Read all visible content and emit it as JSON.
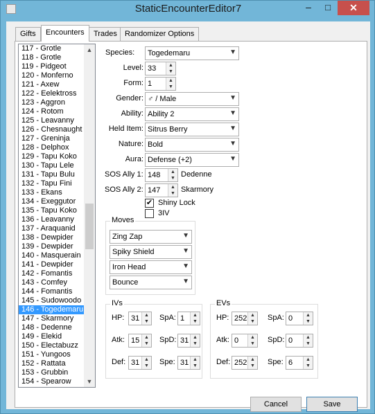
{
  "window": {
    "title": "StaticEncounterEditor7",
    "minimize": "–",
    "maximize": "□",
    "close": "✕"
  },
  "tabs": [
    "Gifts",
    "Encounters",
    "Trades",
    "Randomizer Options"
  ],
  "list": {
    "items": [
      "117 - Grotle",
      "118 - Grotle",
      "119 - Pidgeot",
      "120 - Monferno",
      "121 - Axew",
      "122 - Eelektross",
      "123 - Aggron",
      "124 - Rotom",
      "125 - Leavanny",
      "126 - Chesnaught",
      "127 - Greninja",
      "128 - Delphox",
      "129 - Tapu Koko",
      "130 - Tapu Lele",
      "131 - Tapu Bulu",
      "132 - Tapu Fini",
      "133 - Ekans",
      "134 - Exeggutor",
      "135 - Tapu Koko",
      "136 - Leavanny",
      "137 - Araquanid",
      "138 - Dewpider",
      "139 - Dewpider",
      "140 - Masquerain",
      "141 - Dewpider",
      "142 - Fomantis",
      "143 - Comfey",
      "144 - Fomantis",
      "145 - Sudowoodo",
      "146 - Togedemaru",
      "147 - Skarmory",
      "148 - Dedenne",
      "149 - Elekid",
      "150 - Electabuzz",
      "151 - Yungoos",
      "152 - Rattata",
      "153 - Grubbin",
      "154 - Spearow"
    ],
    "selected_index": 29,
    "scroll_up": "▲",
    "scroll_down": "▼"
  },
  "form": {
    "species_label": "Species:",
    "species": "Togedemaru",
    "level_label": "Level:",
    "level": "33",
    "form_label": "Form:",
    "form": "1",
    "gender_label": "Gender:",
    "gender": "♂ / Male",
    "ability_label": "Ability:",
    "ability": "Ability 2",
    "held_item_label": "Held Item:",
    "held_item": "Sitrus Berry",
    "nature_label": "Nature:",
    "nature": "Bold",
    "aura_label": "Aura:",
    "aura": "Defense (+2)",
    "sos1_label": "SOS Ally 1:",
    "sos1_value": "148",
    "sos1_name": "Dedenne",
    "sos2_label": "SOS Ally 2:",
    "sos2_value": "147",
    "sos2_name": "Skarmory",
    "shiny_lock_label": "Shiny Lock",
    "shiny_lock_checked": true,
    "check_mark": "✔",
    "three_iv_label": "3IV",
    "three_iv_checked": false
  },
  "moves": {
    "title": "Moves",
    "items": [
      "Zing Zap",
      "Spiky Shield",
      "Iron Head",
      "Bounce"
    ]
  },
  "ivs": {
    "title": "IVs",
    "hp_label": "HP:",
    "hp": "31",
    "spa_label": "SpA:",
    "spa": "1",
    "atk_label": "Atk:",
    "atk": "15",
    "spd_label": "SpD:",
    "spd": "31",
    "def_label": "Def:",
    "def": "31",
    "spe_label": "Spe:",
    "spe": "31"
  },
  "evs": {
    "title": "EVs",
    "hp_label": "HP:",
    "hp": "252",
    "spa_label": "SpA:",
    "spa": "0",
    "atk_label": "Atk:",
    "atk": "0",
    "spd_label": "SpD:",
    "spd": "0",
    "def_label": "Def:",
    "def": "252",
    "spe_label": "Spe:",
    "spe": "6"
  },
  "buttons": {
    "cancel": "Cancel",
    "save": "Save"
  },
  "icons": {
    "dropdown": "chevron-down-icon",
    "spin_up": "arrow-up-icon",
    "spin_down": "arrow-down-icon"
  }
}
